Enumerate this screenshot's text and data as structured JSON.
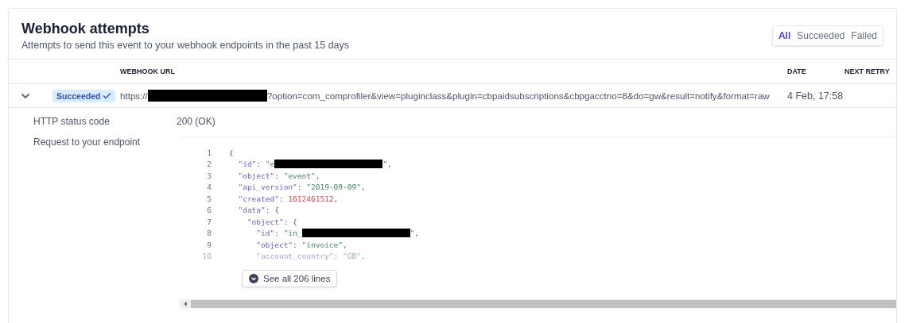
{
  "header": {
    "title": "Webhook attempts",
    "subtitle": "Attempts to send this event to your webhook endpoints in the past 15 days"
  },
  "filters": [
    {
      "label": "All",
      "selected": true
    },
    {
      "label": "Succeeded",
      "selected": false
    },
    {
      "label": "Failed",
      "selected": false
    }
  ],
  "table": {
    "columns": [
      "WEBHOOK URL",
      "DATE",
      "NEXT RETRY"
    ],
    "rows": [
      {
        "expanded": true,
        "status": {
          "label": "Succeeded",
          "kind": "success"
        },
        "url": [
          {
            "kind": "text",
            "text": "https://"
          },
          {
            "kind": "redacted"
          },
          {
            "kind": "text",
            "text": "?option=com_comprofiler&view=pluginclass&plugin=cbpaidsubscriptions&cbpgacctno=8&do=gw&result=notify&format=raw"
          }
        ],
        "date": "4 Feb, 17:58"
      }
    ]
  },
  "details": [
    {
      "label": "HTTP status code",
      "kind": "text",
      "value": "200 (OK)"
    },
    {
      "label": "Request to your endpoint",
      "kind": "code"
    }
  ],
  "code": {
    "lines": [
      {
        "number": "1",
        "faded": false,
        "tokens": [
          {
            "kind": "punct",
            "text": "{"
          }
        ]
      },
      {
        "number": "2",
        "faded": false,
        "tokens": [
          {
            "kind": "key",
            "text": "  \"id\""
          },
          {
            "kind": "punct",
            "text": ": "
          },
          {
            "kind": "string",
            "text": "\"e"
          },
          {
            "kind": "redacted"
          },
          {
            "kind": "string",
            "text": "\""
          },
          {
            "kind": "punct",
            "text": ","
          }
        ]
      },
      {
        "number": "3",
        "faded": false,
        "tokens": [
          {
            "kind": "key",
            "text": "  \"object\""
          },
          {
            "kind": "punct",
            "text": ": "
          },
          {
            "kind": "string",
            "text": "\"event\""
          },
          {
            "kind": "punct",
            "text": ","
          }
        ]
      },
      {
        "number": "4",
        "faded": false,
        "tokens": [
          {
            "kind": "key",
            "text": "  \"api_version\""
          },
          {
            "kind": "punct",
            "text": ": "
          },
          {
            "kind": "string",
            "text": "\"2019-09-09\""
          },
          {
            "kind": "punct",
            "text": ","
          }
        ]
      },
      {
        "number": "5",
        "faded": false,
        "tokens": [
          {
            "kind": "key",
            "text": "  \"created\""
          },
          {
            "kind": "punct",
            "text": ": "
          },
          {
            "kind": "number",
            "text": "1612461512"
          },
          {
            "kind": "punct",
            "text": ","
          }
        ]
      },
      {
        "number": "6",
        "faded": false,
        "tokens": [
          {
            "kind": "key",
            "text": "  \"data\""
          },
          {
            "kind": "punct",
            "text": ": {"
          }
        ]
      },
      {
        "number": "7",
        "faded": false,
        "tokens": [
          {
            "kind": "key",
            "text": "    \"object\""
          },
          {
            "kind": "punct",
            "text": ": {"
          }
        ]
      },
      {
        "number": "8",
        "faded": false,
        "tokens": [
          {
            "kind": "key",
            "text": "      \"id\""
          },
          {
            "kind": "punct",
            "text": ": "
          },
          {
            "kind": "string",
            "text": "\"in_"
          },
          {
            "kind": "redacted"
          },
          {
            "kind": "string",
            "text": "\""
          },
          {
            "kind": "punct",
            "text": ","
          }
        ]
      },
      {
        "number": "9",
        "faded": false,
        "tokens": [
          {
            "kind": "key",
            "text": "      \"object\""
          },
          {
            "kind": "punct",
            "text": ": "
          },
          {
            "kind": "string",
            "text": "\"invoice\""
          },
          {
            "kind": "punct",
            "text": ","
          }
        ]
      },
      {
        "number": "10",
        "faded": true,
        "tokens": [
          {
            "kind": "key",
            "text": "      \"account_country\""
          },
          {
            "kind": "punct",
            "text": ": "
          },
          {
            "kind": "string",
            "text": "\"GB\""
          },
          {
            "kind": "punct",
            "text": ","
          }
        ]
      }
    ],
    "expand_button": "See all 206 lines"
  }
}
